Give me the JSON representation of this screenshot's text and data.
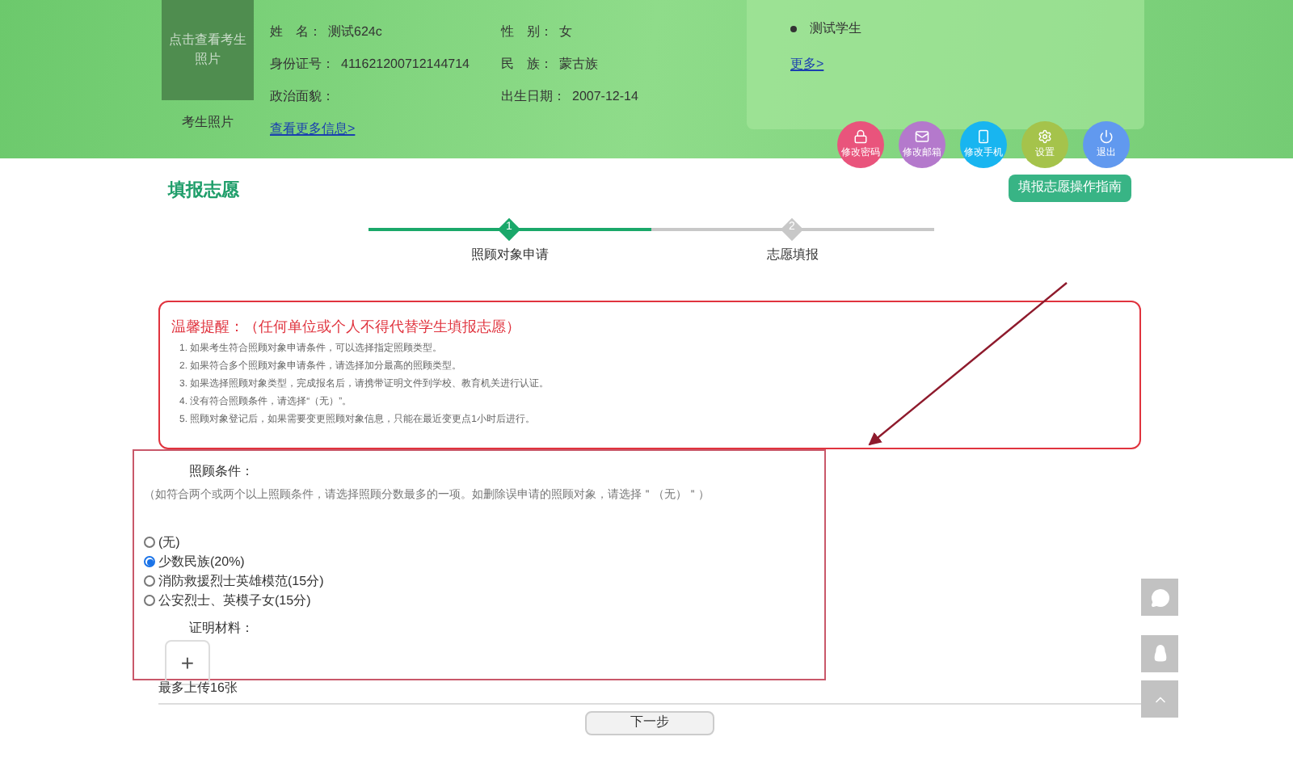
{
  "header": {
    "photo_button": "点击查看考生照片",
    "photo_caption": "考生照片",
    "fields": [
      {
        "label": "姓　名：",
        "value": "测试624c"
      },
      {
        "label": "性　别：",
        "value": "女"
      },
      {
        "label": "身份证号：",
        "value": "411621200712144714"
      },
      {
        "label": "民　族：",
        "value": "蒙古族"
      },
      {
        "label": "政治面貌："
      },
      {
        "label": "出生日期：",
        "value": "2007-12-14"
      }
    ],
    "more_info_link": "查看更多信息>",
    "notice": {
      "items": [
        "测试学生"
      ],
      "more_link": "更多>"
    }
  },
  "actions": [
    {
      "label": "修改密码",
      "color": "#e9547c"
    },
    {
      "label": "修改邮箱",
      "color": "#b479cc"
    },
    {
      "label": "修改手机",
      "color": "#18b5f0"
    },
    {
      "label": "设置",
      "color": "#a5c34b"
    },
    {
      "label": "退出",
      "color": "#6199ef"
    }
  ],
  "section_title": "填报志愿",
  "guide_button": "填报志愿操作指南",
  "steps": [
    {
      "number": "1",
      "label": "照顾对象申请",
      "selected": true
    },
    {
      "number": "2",
      "label": "志愿填报",
      "selected": false
    }
  ],
  "reminder": {
    "title": "温馨提醒：",
    "subtitle": "（任何单位或个人不得代替学生填报志愿）",
    "items": [
      "1. 如果考生符合照顾对象申请条件，可以选择指定照顾类型。",
      "2. 如果符合多个照顾对象申请条件，请选择加分最高的照顾类型。",
      "3. 如果选择照顾对象类型，完成报名后，请携带证明文件到学校、教育机关进行认证。",
      "4. 没有符合照顾条件，请选择“（无）”。",
      "5. 照顾对象登记后，如果需要变更照顾对象信息，只能在最近变更点1小时后进行。"
    ]
  },
  "form": {
    "condition_label": "照顾条件：",
    "hint": "（如符合两个或两个以上照顾条件，请选择照顾分数最多的一项。如删除误申请的照顾对象，请选择＂（无）＂）",
    "options": [
      {
        "label": "(无)",
        "selected": false
      },
      {
        "label": "少数民族(20%)",
        "selected": true
      },
      {
        "label": "消防救援烈士英雄模范(15分)",
        "selected": false
      },
      {
        "label": "公安烈士、英模子女(15分)",
        "selected": false
      }
    ],
    "materials_label": "证明材料：",
    "upload_button": "+",
    "upload_limit": "最多上传16张"
  },
  "next_button": "下一步"
}
